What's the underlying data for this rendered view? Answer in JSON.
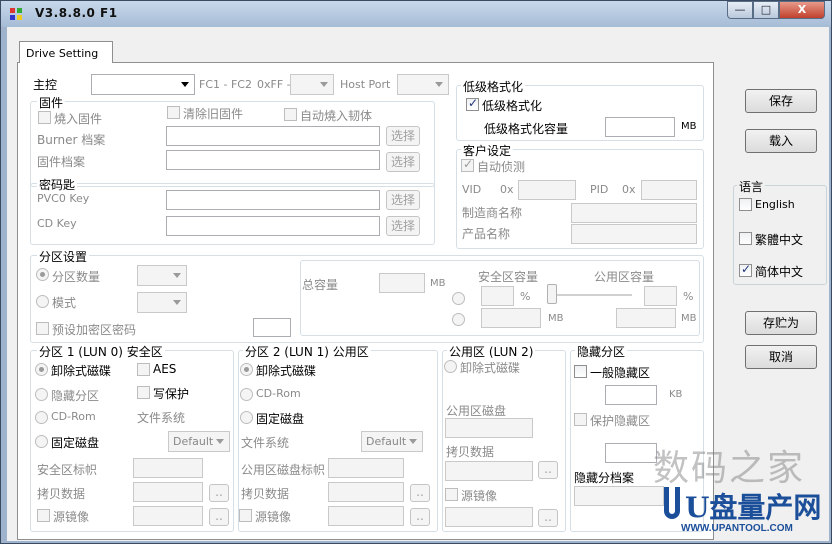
{
  "window": {
    "title": "V3.8.8.0 F1",
    "buttons": {
      "minimize": "—",
      "maximize": "□",
      "close": "X"
    }
  },
  "tab": {
    "label": "Drive Setting"
  },
  "master": {
    "label": "主控",
    "fc_range": "FC1 - FC2",
    "hex_prefix": "0xFF -",
    "host_port_label": "Host Port"
  },
  "firmware": {
    "title": "固件",
    "burn_fw": "燒入固件",
    "clear_old_fw": "清除旧固件",
    "auto_burn": "自动燒入韧体",
    "burner_file": "Burner 档案",
    "fw_file": "固件档案",
    "browse": "选择"
  },
  "keys": {
    "title": "密码匙",
    "pvc0": "PVC0 Key",
    "cd": "CD Key",
    "browse": "选择"
  },
  "lowformat": {
    "title": "低级格式化",
    "enable": "低级格式化",
    "capacity": "低级格式化容量",
    "unit": "MB"
  },
  "customer": {
    "title": "客户设定",
    "auto_detect": "自动侦测",
    "vid": "VID",
    "pid": "PID",
    "hex": "0x",
    "vendor": "制造商名称",
    "product": "产品名称"
  },
  "partition": {
    "title": "分区设置",
    "count": "分区数量",
    "mode": "模式",
    "preset_pwd": "预设加密区密码",
    "total": "总容量",
    "unit": "MB",
    "secure_cap": "安全区容量",
    "public_cap": "公用区容量",
    "percent": "%"
  },
  "part1": {
    "title": "分区 1 (LUN 0) 安全区",
    "removable": "卸除式磁碟",
    "aes": "AES",
    "hidden": "隐藏分区",
    "write_protect": "写保护",
    "cdrom": "CD-Rom",
    "fs": "文件系统",
    "fixed": "固定磁盘",
    "fs_value": "Default",
    "secure_label": "安全区标帜",
    "copy_data": "拷贝数据",
    "mirror": "源镜像",
    "dots": ".."
  },
  "part2": {
    "title": "分区 2 (LUN 1) 公用区",
    "removable": "卸除式磁碟",
    "cdrom": "CD-Rom",
    "fixed": "固定磁盘",
    "fs": "文件系统",
    "fs_value": "Default",
    "public_label": "公用区磁盘标帜",
    "copy_data": "拷贝数据",
    "mirror": "源镜像",
    "dots": ".."
  },
  "public_lun2": {
    "title": "公用区 (LUN 2)",
    "removable": "卸除式磁碟",
    "public_disk": "公用区磁盘",
    "copy_data": "拷贝数据",
    "mirror": "源镜像",
    "dots": ".."
  },
  "hidden": {
    "title": "隐藏分区",
    "normal": "一般隐藏区",
    "unit": "KB",
    "protect": "保护隐藏区",
    "file": "隐藏分档案"
  },
  "side": {
    "save": "保存",
    "load": "载入",
    "language_title": "语言",
    "english": "English",
    "traditional": "繁體中文",
    "simplified": "简体中文",
    "save_as": "存贮为",
    "cancel": "取消"
  },
  "watermark": {
    "top": "数码之家",
    "logo": "U盘量产网",
    "url": "WWW.UPANTOOL.COM"
  }
}
